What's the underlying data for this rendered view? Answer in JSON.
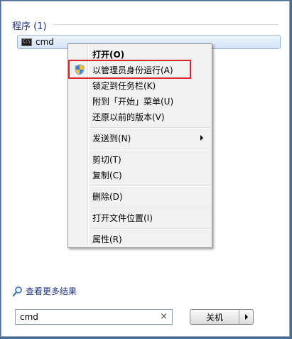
{
  "programs": {
    "header": "程序 (1)",
    "items": [
      {
        "label": "cmd",
        "icon": "command-prompt-icon"
      }
    ]
  },
  "context_menu": {
    "items": [
      {
        "label": "打开(O)",
        "bold": true
      },
      {
        "label": "以管理员身份运行(A)",
        "icon": "uac-shield-icon",
        "highlighted": true
      },
      {
        "label": "锁定到任务栏(K)"
      },
      {
        "label": "附到「开始」菜单(U)"
      },
      {
        "label": "还原以前的版本(V)"
      },
      {
        "label": "发送到(N)",
        "submenu": true
      },
      {
        "label": "剪切(T)"
      },
      {
        "label": "复制(C)"
      },
      {
        "label": "删除(D)"
      },
      {
        "label": "打开文件位置(I)"
      },
      {
        "label": "属性(R)"
      }
    ]
  },
  "more_results": {
    "label": "查看更多结果",
    "icon": "magnifier-icon"
  },
  "search": {
    "value": "cmd",
    "clear_icon": "×"
  },
  "shutdown": {
    "label": "关机",
    "arrow_icon": "arrow-right-icon"
  },
  "colors": {
    "highlight_border": "#d9262a",
    "header_text": "#1e3287"
  }
}
